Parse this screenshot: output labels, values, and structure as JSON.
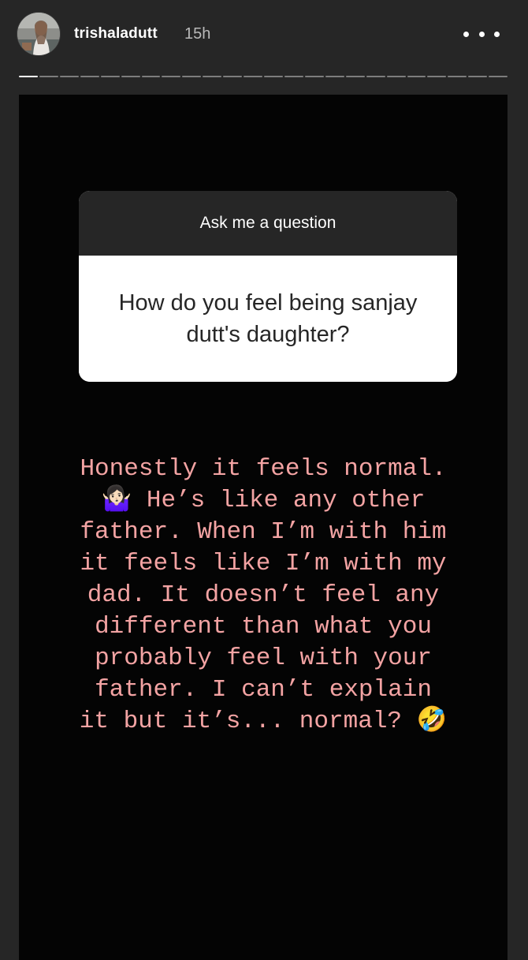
{
  "header": {
    "username": "trishaladutt",
    "time": "15h",
    "avatar_icon": "profile-photo",
    "more_icon": "more-horizontal-icon"
  },
  "progress": {
    "segments_total": 24,
    "segments_viewed": 1
  },
  "question_sticker": {
    "title": "Ask me a question",
    "question": "How do you feel being sanjay dutt's daughter?"
  },
  "answer": {
    "lines": [
      "Honestly it feels normal.",
      "🤷🏻‍♀️ He’s like any other",
      "father. When I’m with him",
      "it feels like I’m with my",
      "dad. It doesn’t feel any",
      "different than what you",
      "probably feel with your",
      "father. I can’t explain",
      "it but it’s... normal? 🤣"
    ],
    "color": "#f3a3a3"
  }
}
